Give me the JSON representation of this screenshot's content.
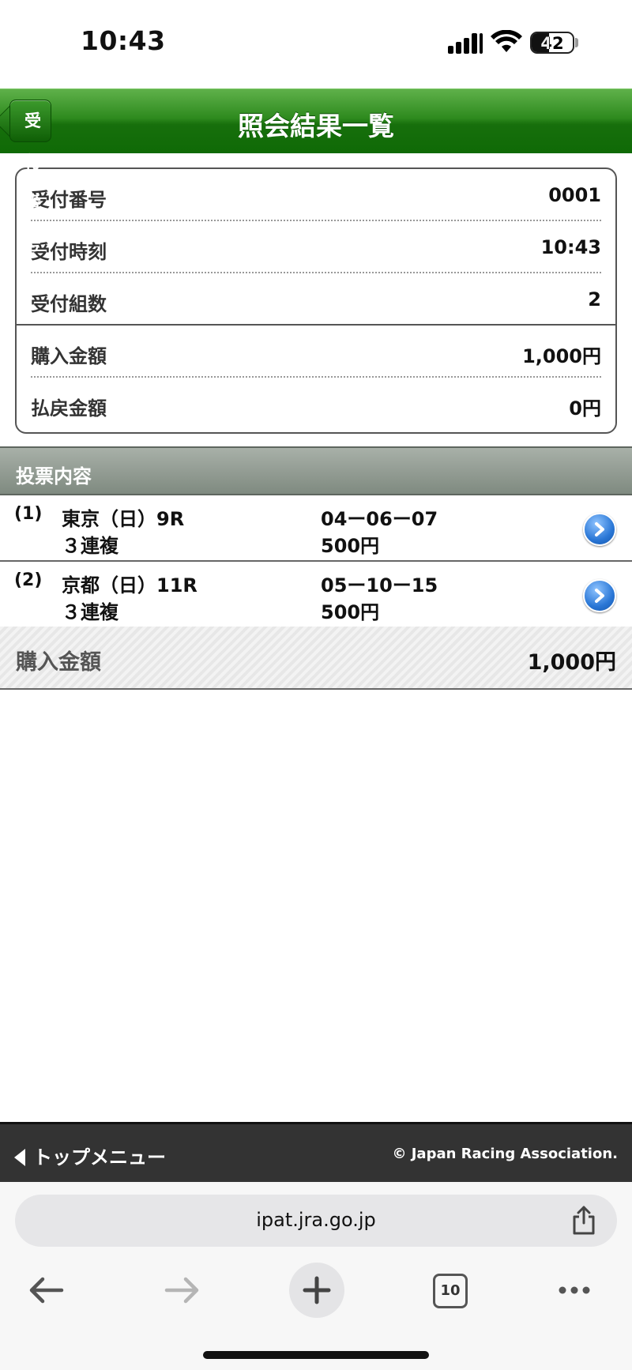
{
  "status_bar": {
    "time": "10:43",
    "battery": "42",
    "signal_icon": "cellular-signal-icon",
    "wifi_icon": "wifi-icon"
  },
  "nav": {
    "back_label": "受付番号",
    "title": "照会結果一覧"
  },
  "receipt": {
    "rows": [
      {
        "key": "受付番号",
        "value": "0001"
      },
      {
        "key": "受付時刻",
        "value": "10:43"
      },
      {
        "key": "受付組数",
        "value": "2"
      },
      {
        "key": "購入金額",
        "value": "1,000円"
      },
      {
        "key": "払戻金額",
        "value": "0円"
      }
    ]
  },
  "section": {
    "title": "投票内容"
  },
  "votes": [
    {
      "index": "(1)",
      "race": "東京（日）9R",
      "kind": "３連複",
      "combo": "04ー06ー07",
      "amount": "500円"
    },
    {
      "index": "(2)",
      "race": "京都（日）11R",
      "kind": "３連複",
      "combo": "05ー10ー15",
      "amount": "500円"
    }
  ],
  "total": {
    "label": "購入金額",
    "value": "1,000円"
  },
  "footer": {
    "menu_label": "トップメニュー",
    "copyright": "© Japan Racing Association."
  },
  "browser": {
    "url": "ipat.jra.go.jp",
    "tab_count": "10"
  }
}
